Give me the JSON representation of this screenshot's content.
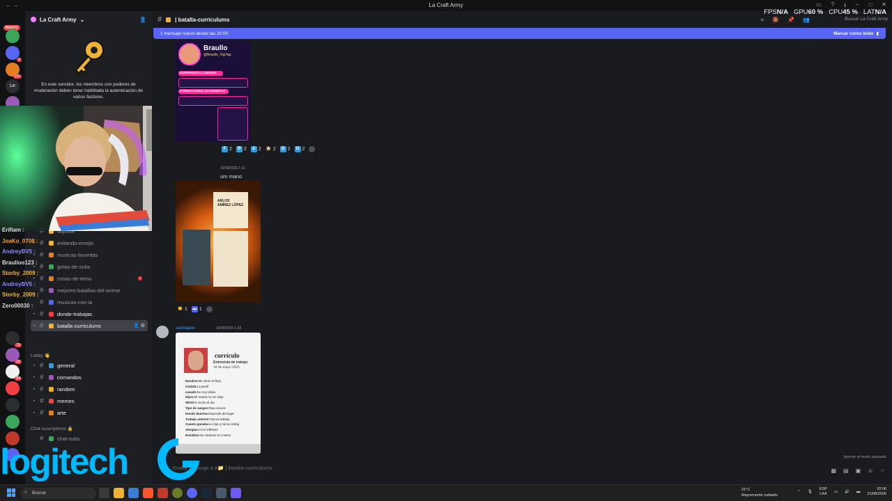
{
  "window": {
    "title": "La Craft Army",
    "nav": "← →"
  },
  "servers": {
    "new_badge": "NUEVO",
    "items": [
      {
        "color": "#3ba55c",
        "badge": ""
      },
      {
        "color": "#5865f2",
        "badge": "2"
      },
      {
        "color": "#e67e22",
        "badge": "141"
      },
      {
        "color": "#2b2d31",
        "badge": "",
        "text": "Le"
      },
      {
        "color": "#9b59b6",
        "badge": "37"
      }
    ],
    "lower_badges": [
      "76",
      "16",
      "84"
    ]
  },
  "guild": {
    "name": "La Craft Army",
    "mfa_notice": "En este servidor, los miembros con poderes de moderación deben tener habilitada la autenticación de varios factores."
  },
  "channels": [
    {
      "name": "soporte",
      "arrow": false,
      "color": "#f0b232"
    },
    {
      "name": "imitando-emojis",
      "arrow": true,
      "color": "#f0b232"
    },
    {
      "name": "musicas-favoritas",
      "arrow": true,
      "color": "#e67e22"
    },
    {
      "name": "gotas-de-subs",
      "arrow": true,
      "color": "#3ba55c"
    },
    {
      "name": "cosas-de-temu",
      "arrow": true,
      "color": "#e67e22",
      "unread": true
    },
    {
      "name": "mejores-batallas-del-anime",
      "arrow": false,
      "color": "#9b59b6"
    },
    {
      "name": "musicas-con-ia",
      "arrow": false,
      "color": "#5865f2"
    },
    {
      "name": "donde-trabajas",
      "arrow": true,
      "color": "#f23f43",
      "bright": true
    },
    {
      "name": "batalla-curriculums",
      "arrow": true,
      "color": "#f0b232",
      "active": true
    }
  ],
  "lobby": {
    "category": "Lobby 👋",
    "channels": [
      {
        "name": "general",
        "color": "#3498db"
      },
      {
        "name": "comandos",
        "color": "#9b59b6"
      },
      {
        "name": "random",
        "color": "#f0b232"
      },
      {
        "name": "memes",
        "color": "#f23f43"
      },
      {
        "name": "arte",
        "color": "#e67e22"
      }
    ]
  },
  "subs": {
    "category": "Chat-suscriptores 🔒",
    "channels": [
      {
        "name": "chat-subs",
        "color": "#3ba55c"
      }
    ]
  },
  "stream_chat": [
    {
      "user": "Erifiam",
      "color": "#dbdee1"
    },
    {
      "user": "JoaKo_0708",
      "color": "#ff9f1c"
    },
    {
      "user": "AndreyBV5",
      "color": "#8b8bff"
    },
    {
      "user": "Braulioo123",
      "color": "#dbdee1"
    },
    {
      "user": "Storby_2009",
      "color": "#f0b232"
    },
    {
      "user": "AndreyBV5",
      "color": "#8b8bff"
    },
    {
      "user": "Storby_2009",
      "color": "#f0b232"
    },
    {
      "user": "Zero00030",
      "color": "#dbdee1"
    }
  ],
  "header": {
    "channel": "batalla-curriculums",
    "stats": [
      {
        "label": "FPS",
        "value": "N/A"
      },
      {
        "label": "GPU",
        "value": "60 %"
      },
      {
        "label": "CPU",
        "value": "45 %"
      },
      {
        "label": "LAT",
        "value": "N/A"
      }
    ],
    "search_placeholder": "Buscar La Craft Army"
  },
  "new_messages": {
    "text": "1 mensaje nuevo desde las 20:00",
    "mark_read": "Marcar como leído"
  },
  "reactions_row1": [
    {
      "letter": "F",
      "color": "#3498db",
      "count": "2"
    },
    {
      "letter": "R",
      "color": "#3498db",
      "count": "2"
    },
    {
      "letter": "A",
      "color": "#3498db",
      "count": "2"
    },
    {
      "letter": "🏠",
      "color": "transparent",
      "count": "2"
    },
    {
      "letter": "D",
      "color": "#3498db",
      "count": "2"
    },
    {
      "letter": "O",
      "color": "#3498db",
      "count": "2"
    }
  ],
  "message2": {
    "time": "20/08/2026 1:31",
    "text": "um mano"
  },
  "reactions_row2": [
    {
      "letter": "👏",
      "color": "transparent",
      "count": "1"
    },
    {
      "letter": "▬",
      "color": "#5865f2",
      "count": "1"
    }
  ],
  "message3": {
    "author": "sachapov",
    "time": "19/08/2026 1:33",
    "card": {
      "title": "currículo",
      "subtitle": "Entrevista de trabajo",
      "date": "18 de mayo 2025",
      "fields": [
        {
          "k": "Nombre:",
          "v": "Me dicen el flojo"
        },
        {
          "k": "Codula:",
          "v": "La perdí"
        },
        {
          "k": "casado:",
          "v": "No soy idiota"
        },
        {
          "k": "Hijos:",
          "v": "Mi mamá no me deja"
        },
        {
          "k": "SEXO:",
          "v": "5 veces al día"
        },
        {
          "k": "Tipo de sangre:",
          "v": "Roja oscura"
        },
        {
          "k": "Donde duermo:",
          "v": "Depende del lugar"
        },
        {
          "k": "Trabajo anterior:",
          "v": "Nunca trabajo"
        },
        {
          "k": "Cuanto ganaba:",
          "v": "Le dije q nunca trabaj"
        },
        {
          "k": "Alergias:",
          "v": "A los inflelses"
        },
        {
          "k": "Estudios:",
          "v": "No estamos en mismo"
        }
      ]
    }
  },
  "braulio_card": {
    "name": "Braullo",
    "handle": "@Braullo_TapTap",
    "section1": "EXPERIENCIA LABORAL",
    "section2": "FORMACIONES ACADEMICAS"
  },
  "carlos_card": {
    "name": "ARLOS\nAMÍREZ LÓPEZ"
  },
  "composer": {
    "placeholder": "Enviar mensaje a #📁 | batalla-curriculums"
  },
  "paused": "Ignorar al modo pausado",
  "overlay": {
    "logo": "logitech"
  },
  "taskbar": {
    "search": "Buscar",
    "weather_temp": "21°C",
    "weather_desc": "Mayormente nublado",
    "lang1": "ESP",
    "lang2": "LAA",
    "time": "20:06",
    "date": "21/08/2026"
  }
}
